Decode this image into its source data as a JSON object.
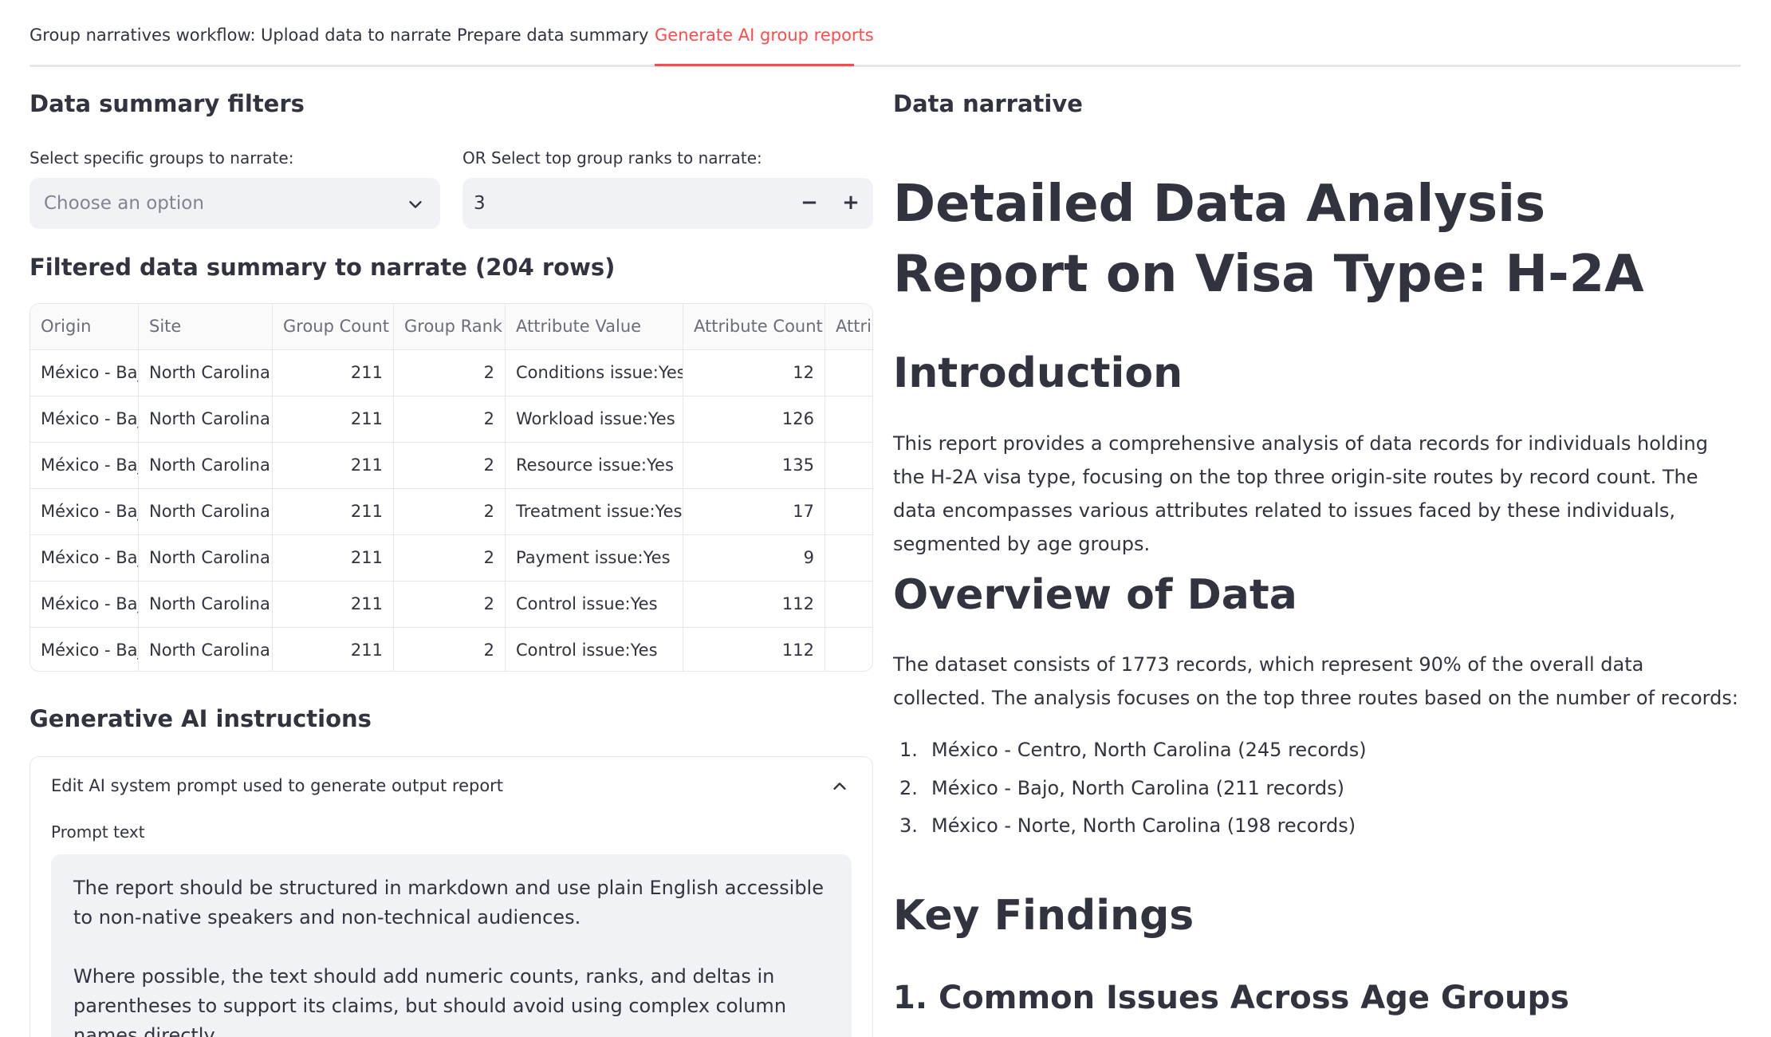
{
  "tabs": {
    "workflow_label": "Group narratives workflow:",
    "items": [
      "Upload data to narrate",
      "Prepare data summary",
      "Generate AI group reports"
    ],
    "active_index": 2
  },
  "filters": {
    "title": "Data summary filters",
    "groups_label": "Select specific groups to narrate:",
    "groups_placeholder": "Choose an option",
    "ranks_label": "OR Select top group ranks to narrate:",
    "ranks_value": "3",
    "minus": "−",
    "plus": "+"
  },
  "summary_table": {
    "title": "Filtered data summary to narrate (204 rows)",
    "columns": [
      "Origin",
      "Site",
      "Group Count",
      "Group Rank",
      "Attribute Value",
      "Attribute Count",
      "Attrib"
    ],
    "rows": [
      [
        "México - Bajo",
        "North Carolina",
        "211",
        "2",
        "Conditions issue:Yes",
        "12",
        ""
      ],
      [
        "México - Bajo",
        "North Carolina",
        "211",
        "2",
        "Workload issue:Yes",
        "126",
        ""
      ],
      [
        "México - Bajo",
        "North Carolina",
        "211",
        "2",
        "Resource issue:Yes",
        "135",
        ""
      ],
      [
        "México - Bajo",
        "North Carolina",
        "211",
        "2",
        "Treatment issue:Yes",
        "17",
        ""
      ],
      [
        "México - Bajo",
        "North Carolina",
        "211",
        "2",
        "Payment issue:Yes",
        "9",
        ""
      ],
      [
        "México - Bajo",
        "North Carolina",
        "211",
        "2",
        "Control issue:Yes",
        "112",
        ""
      ],
      [
        "México - Bajo",
        "North Carolina",
        "211",
        "2",
        "Control issue:Yes",
        "112",
        ""
      ]
    ]
  },
  "ai": {
    "title": "Generative AI instructions",
    "expander_title": "Edit AI system prompt used to generate output report",
    "prompt_label": "Prompt text",
    "prompt_paragraphs": [
      "The report should be structured in markdown and use plain English accessible to non-native speakers and non-technical audiences.",
      "Where possible, the text should add numeric counts, ranks, and deltas in parentheses to support its claims, but should avoid using complex column names directly."
    ]
  },
  "narrative": {
    "title": "Data narrative",
    "h1": "Detailed Data Analysis Report on Visa Type: H-2A",
    "intro_heading": "Introduction",
    "intro_text": "This report provides a comprehensive analysis of data records for individuals holding the H-2A visa type, focusing on the top three origin-site routes by record count. The data encompasses various attributes related to issues faced by these individuals, segmented by age groups.",
    "overview_heading": "Overview of Data",
    "overview_text": "The dataset consists of 1773 records, which represent 90% of the overall data collected. The analysis focuses on the top three routes based on the number of records:",
    "routes": [
      {
        "num": "1.",
        "text": "México - Centro, North Carolina (245 records)"
      },
      {
        "num": "2.",
        "text": "México - Bajo, North Carolina (211 records)"
      },
      {
        "num": "3.",
        "text": "México - Norte, North Carolina (198 records)"
      }
    ],
    "findings_heading": "Key Findings",
    "findings_sub1": "1. Common Issues Across Age Groups"
  },
  "icons": {
    "select_chevron": "chevron-down-icon",
    "expander_chevron": "chevron-up-icon"
  },
  "colors": {
    "accent": "#ff4b4b",
    "text": "#31333f",
    "input_bg": "#f0f2f6",
    "border": "#e6e7eb"
  }
}
